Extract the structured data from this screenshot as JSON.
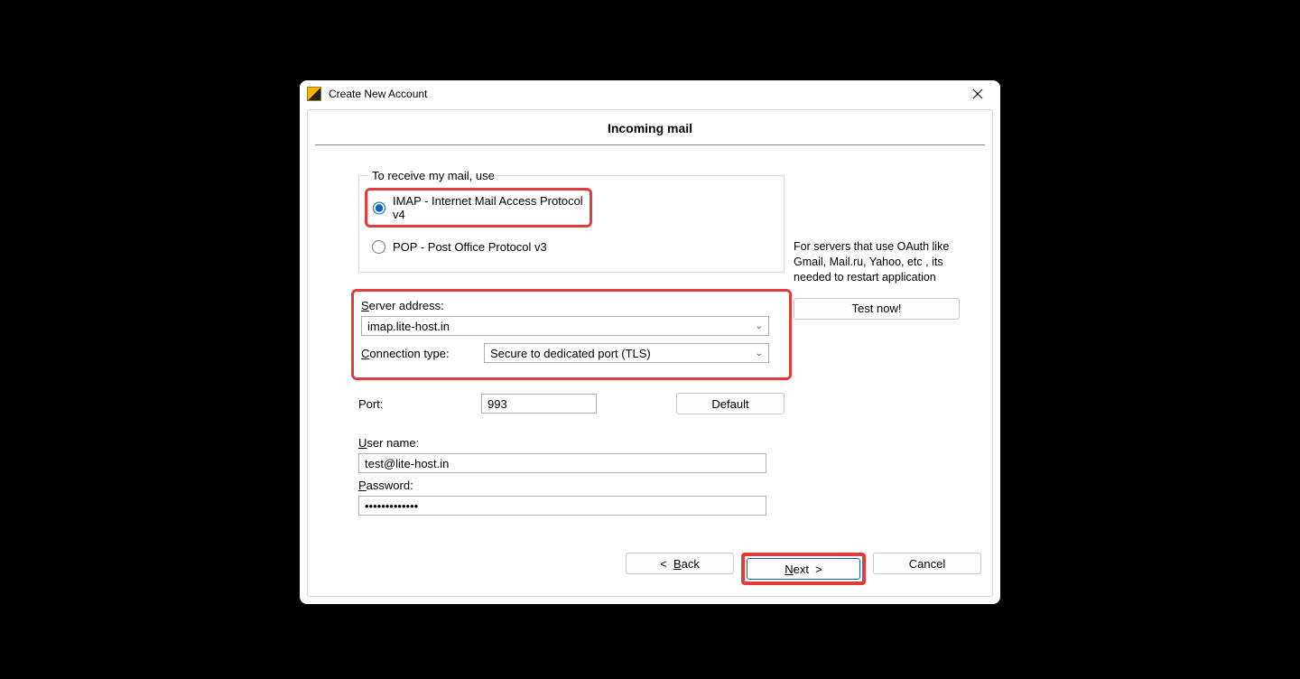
{
  "window_title": "Create New Account",
  "page_title": "Incoming mail",
  "protocol": {
    "legend": "To receive my mail, use",
    "imap_label": "IMAP - Internet Mail Access Protocol v4",
    "pop_label": "POP  -  Post Office Protocol v3"
  },
  "server": {
    "address_label": "Server address:",
    "address_value": "imap.lite-host.in",
    "conn_label": "Connection type:",
    "conn_value": "Secure to dedicated port (TLS)"
  },
  "port": {
    "label": "Port:",
    "value": "993",
    "default_btn": "Default"
  },
  "user": {
    "label": "User name:",
    "value": "test@lite-host.in"
  },
  "password": {
    "label": "Password:",
    "value": "•••••••••••••"
  },
  "oauth_text": "For servers that use OAuth like Gmail, Mail.ru, Yahoo, etc , its needed to restart application",
  "test_btn": "Test now!",
  "footer": {
    "back": "Back",
    "next": "Next",
    "cancel": "Cancel"
  }
}
